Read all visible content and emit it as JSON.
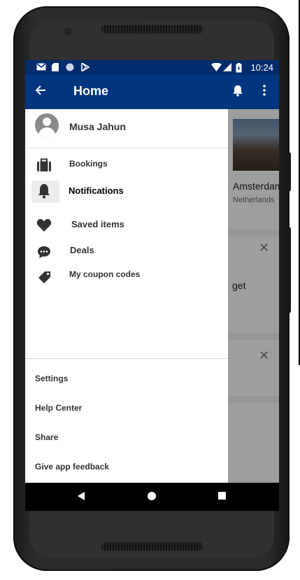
{
  "status_bar": {
    "time": "10:24",
    "icons": [
      "gmail-icon",
      "sd-card-icon",
      "circle-icon",
      "play-store-icon",
      "wifi-icon",
      "signal-icon",
      "battery-icon"
    ]
  },
  "app_bar": {
    "title": "Home",
    "back_icon": "arrow-left-icon",
    "actions": [
      "bell-icon",
      "more-vert-icon"
    ],
    "color": "#003580"
  },
  "drawer": {
    "user_name": "Musa Jahun",
    "items": [
      {
        "label": "Bookings",
        "icon": "briefcase-icon"
      },
      {
        "label": "Notifications",
        "icon": "bell-icon",
        "active": true
      },
      {
        "label": "Saved items",
        "icon": "heart-icon"
      },
      {
        "label": "Deals",
        "icon": "chat-bubble-icon"
      },
      {
        "label": "My coupon codes",
        "icon": "tag-icon"
      }
    ],
    "bottom_items": [
      {
        "label": "Settings"
      },
      {
        "label": "Help Center"
      },
      {
        "label": "Share"
      },
      {
        "label": "Give app feedback"
      }
    ]
  },
  "background": {
    "card1": {
      "city": "Amsterdam",
      "country": "Netherlands"
    },
    "card2": {
      "text": "get"
    }
  }
}
